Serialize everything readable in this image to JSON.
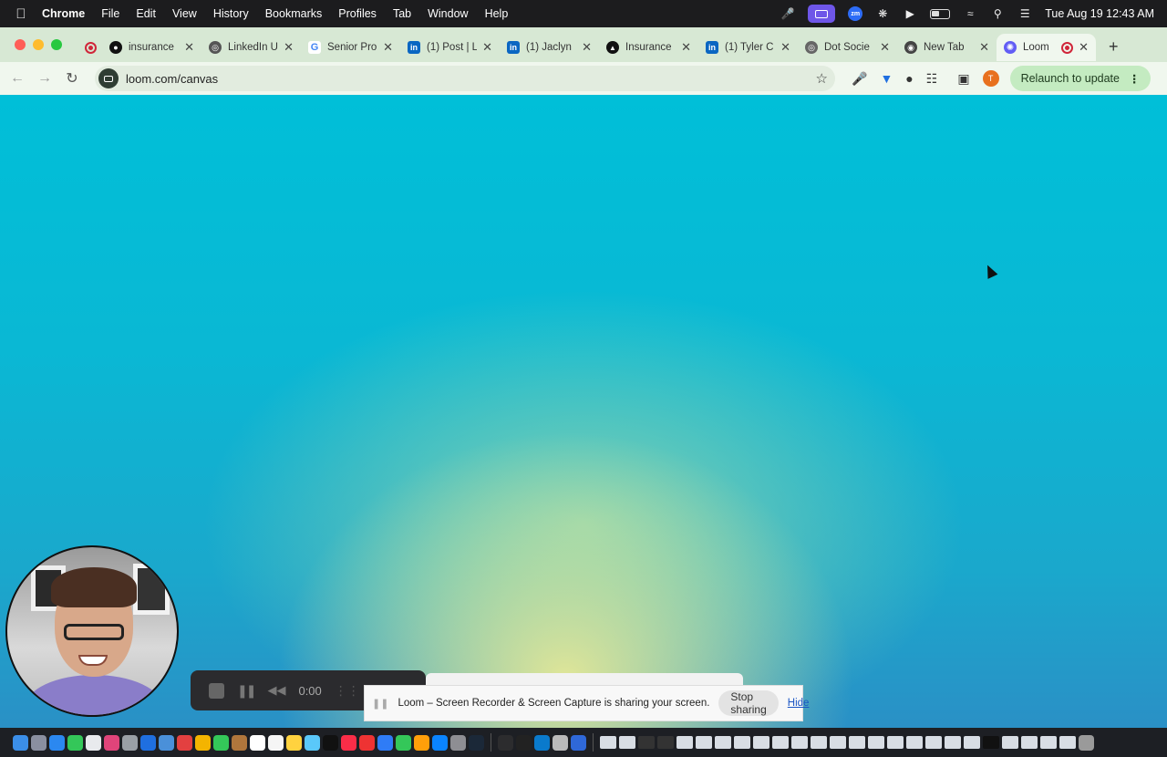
{
  "menubar": {
    "app_name": "Chrome",
    "menus": [
      "File",
      "Edit",
      "View",
      "History",
      "Bookmarks",
      "Profiles",
      "Tab",
      "Window",
      "Help"
    ],
    "clock": "Tue Aug 19  12:43 AM",
    "zoom_label": "zm"
  },
  "tabs": [
    {
      "title": "insurance",
      "icon": "github-icon",
      "color": "#111111"
    },
    {
      "title": "LinkedIn U",
      "icon": "globe-icon",
      "color": "#444444"
    },
    {
      "title": "Senior Pro",
      "icon": "google-icon",
      "color": "#ffffff"
    },
    {
      "title": "(1) Post | L",
      "icon": "linkedin-icon",
      "color": "#0a66c2"
    },
    {
      "title": "(1) Jaclyn",
      "icon": "linkedin-icon",
      "color": "#0a66c2"
    },
    {
      "title": "Insurance",
      "icon": "triangle-icon",
      "color": "#111111"
    },
    {
      "title": "(1) Tyler C",
      "icon": "linkedin-icon",
      "color": "#0a66c2"
    },
    {
      "title": "Dot Socie",
      "icon": "globe-icon",
      "color": "#555555"
    },
    {
      "title": "New Tab",
      "icon": "chrome-icon",
      "color": "#444444"
    },
    {
      "title": "Loom",
      "icon": "loom-icon",
      "color": "#625df5",
      "active": true
    }
  ],
  "toolbar": {
    "url": "loom.com/canvas",
    "relaunch_label": "Relaunch to update",
    "profile_initial": "T"
  },
  "loom": {
    "timer": "0:00",
    "share_message": "Loom – Screen Recorder & Screen Capture is sharing your screen.",
    "stop_label": "Stop sharing",
    "hide_label": "Hide"
  },
  "colors": {
    "recording_red": "#d0263a",
    "tabstrip_bg": "#d7e8d4",
    "relaunch_bg": "#c4ebc1",
    "canvas_top": "#00bfd8",
    "canvas_glow": "#e8e996"
  }
}
